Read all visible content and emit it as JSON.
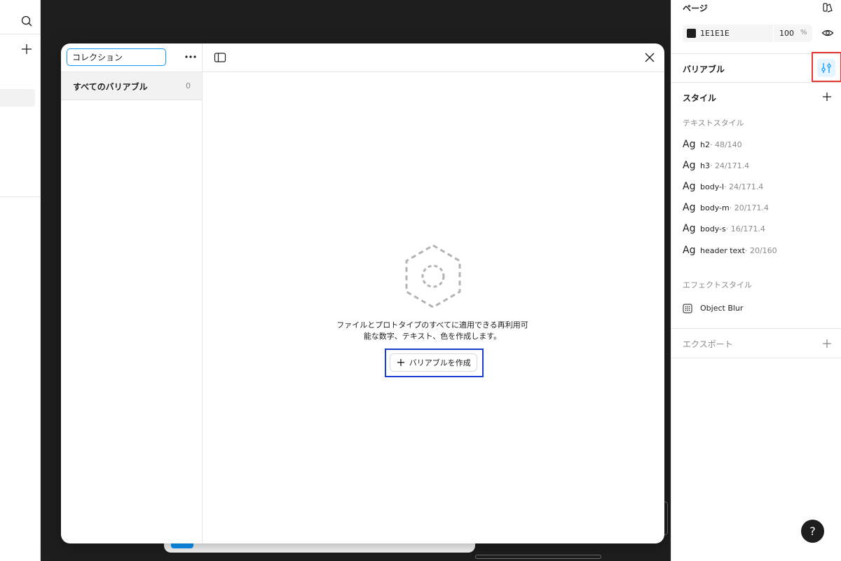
{
  "modal": {
    "collection_name_input": "コレクション",
    "collections": [
      {
        "label": "すべてのバリアブル",
        "count": "0"
      }
    ],
    "empty_text_line1": "ファイルとプロトタイプのすべてに適用できる再利用可",
    "empty_text_line2": "能な数字、テキスト、色を作成します。",
    "create_button_label": "バリアブルを作成"
  },
  "right_panel": {
    "page_title": "ページ",
    "background": {
      "hex": "1E1E1E",
      "opacity": "100",
      "percent": "%"
    },
    "variables_label": "バリアブル",
    "styles_label": "スタイル",
    "text_styles_label": "テキストスタイル",
    "text_styles": [
      {
        "ag": "Ag",
        "name": "h2",
        "meta": " · 48/140"
      },
      {
        "ag": "Ag",
        "name": "h3",
        "meta": " · 24/171.4"
      },
      {
        "ag": "Ag",
        "name": "body-l",
        "meta": " · 24/171.4"
      },
      {
        "ag": "Ag",
        "name": "body-m",
        "meta": " · 20/171.4"
      },
      {
        "ag": "Ag",
        "name": "body-s",
        "meta": " · 16/171.4"
      },
      {
        "ag": "Ag",
        "name": "header text",
        "meta": " · 20/160"
      }
    ],
    "effect_styles_label": "エフェクトスタイル",
    "effect_styles": [
      {
        "name": "Object Blur",
        "icon": "grid-blur-icon"
      }
    ],
    "export_label": "エクスポート",
    "help_label": "?"
  },
  "colors": {
    "accent_blue": "#0d99ff",
    "highlight_red": "#e53935",
    "highlight_blue": "#1a3ecf",
    "canvas_bg": "#1e1e1e"
  }
}
